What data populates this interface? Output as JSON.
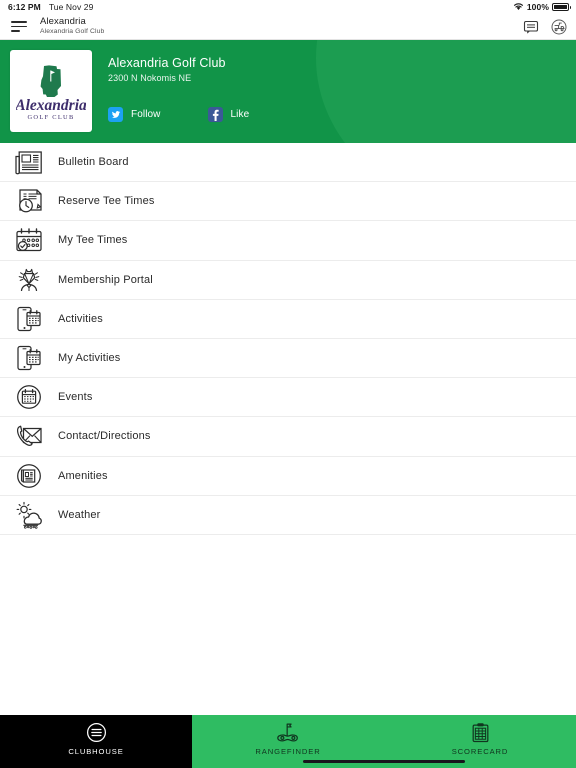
{
  "status_bar": {
    "time": "6:12 PM",
    "date": "Tue Nov 29",
    "battery_percent": "100%",
    "wifi_icon": "wifi-icon",
    "battery_icon": "battery-full-icon"
  },
  "nav_bar": {
    "menu_icon": "hamburger-menu-icon",
    "title": "Alexandria",
    "subtitle": "Alexandria Golf Club",
    "chat_icon": "chat-bubble-icon",
    "cart_icon": "golf-cart-icon"
  },
  "hero": {
    "background_color": "#119448",
    "arc_color": "#1c9d51",
    "logo": {
      "icon": "alexandria-golf-club-logo",
      "script_text": "Alexandria",
      "sub_text": "GOLF CLUB",
      "state_shape": "minnesota-state-icon",
      "script_color": "#3d2d6b",
      "state_color": "#1f7a4d"
    },
    "club_name": "Alexandria Golf Club",
    "address": "2300 N Nokomis NE",
    "social": [
      {
        "label": "Follow",
        "icon": "twitter-icon",
        "color": "#1da1f2"
      },
      {
        "label": "Like",
        "icon": "facebook-icon",
        "color": "#3b5998"
      }
    ]
  },
  "menu": {
    "items": [
      {
        "label": "Bulletin Board",
        "icon": "newspaper-icon"
      },
      {
        "label": "Reserve Tee Times",
        "icon": "clock-document-icon"
      },
      {
        "label": "My Tee Times",
        "icon": "calendar-check-icon"
      },
      {
        "label": "Membership Portal",
        "icon": "member-badge-icon"
      },
      {
        "label": "Activities",
        "icon": "phone-calendar-icon"
      },
      {
        "label": "My Activities",
        "icon": "phone-calendar-icon"
      },
      {
        "label": "Events",
        "icon": "calendar-circle-icon"
      },
      {
        "label": "Contact/Directions",
        "icon": "phone-envelope-icon"
      },
      {
        "label": "Amenities",
        "icon": "list-circle-icon"
      },
      {
        "label": "Weather",
        "icon": "sun-cloud-rain-icon"
      }
    ]
  },
  "tab_bar": {
    "active_color": "#000000",
    "inactive_color": "#2fbc62",
    "tabs": [
      {
        "label": "CLUBHOUSE",
        "icon": "clubhouse-menu-icon",
        "active": true
      },
      {
        "label": "RANGEFINDER",
        "icon": "rangefinder-icon",
        "active": false
      },
      {
        "label": "SCORECARD",
        "icon": "scorecard-clipboard-icon",
        "active": false
      }
    ]
  }
}
